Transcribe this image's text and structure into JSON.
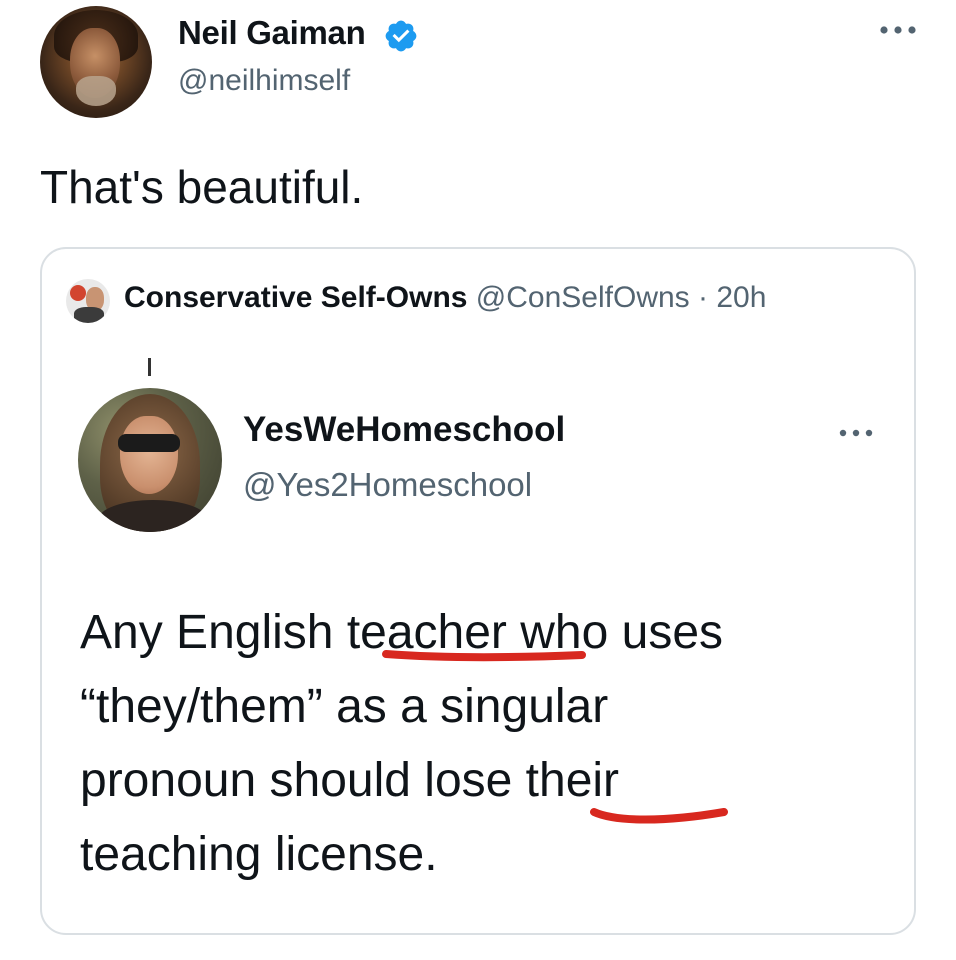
{
  "author": {
    "display_name": "Neil Gaiman",
    "handle": "@neilhimself",
    "verified": true,
    "verified_color": "#1d9bf0"
  },
  "tweet": {
    "text": "That's beautiful."
  },
  "quote": {
    "name": "Conservative Self-Owns",
    "handle": "@ConSelfOwns",
    "separator": " · ",
    "time": "20h",
    "inner": {
      "name": "YesWeHomeschool",
      "handle": "@Yes2Homeschool",
      "lines": [
        "Any English teacher who uses",
        "“they/them” as a singular",
        "pronoun should lose their",
        "teaching license."
      ],
      "underlined_words": [
        "teacher",
        "their"
      ],
      "underline_color": "#d8281f"
    }
  },
  "icons": {
    "more": "more-horizontal-icon",
    "verified": "verified-badge-icon"
  }
}
